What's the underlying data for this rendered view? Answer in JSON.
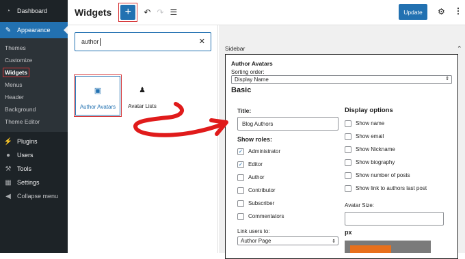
{
  "sidebar": {
    "dashboard": "Dashboard",
    "appearance": "Appearance",
    "submenu": [
      "Themes",
      "Customize",
      "Widgets",
      "Menus",
      "Header",
      "Background",
      "Theme Editor"
    ],
    "plugins": "Plugins",
    "users": "Users",
    "tools": "Tools",
    "settings": "Settings",
    "collapse": "Collapse menu"
  },
  "header": {
    "title": "Widgets",
    "add": "+",
    "update": "Update"
  },
  "inserter": {
    "search_value": "author",
    "blocks": [
      {
        "label": "Author Avatars"
      },
      {
        "label": "Avatar Lists"
      }
    ]
  },
  "editor": {
    "area": "Sidebar",
    "widget": {
      "title": "Author Avatars",
      "sorting_label": "Sorting order:",
      "sorting_value": "Display Name",
      "basic": "Basic",
      "title_label": "Title:",
      "title_value": "Blog Authors",
      "roles_label": "Show roles:",
      "roles": [
        {
          "label": "Administrator",
          "checked": true
        },
        {
          "label": "Editor",
          "checked": true
        },
        {
          "label": "Author",
          "checked": false
        },
        {
          "label": "Contributor",
          "checked": false
        },
        {
          "label": "Subscriber",
          "checked": false
        },
        {
          "label": "Commentators",
          "checked": false
        }
      ],
      "link_label": "Link users to:",
      "link_value": "Author Page",
      "display_label": "Display options",
      "display_options": [
        "Show name",
        "Show email",
        "Show Nickname",
        "Show biography",
        "Show number of posts",
        "Show link to authors last post"
      ],
      "avatar_size_label": "Avatar Size:",
      "px": "px"
    }
  },
  "colors": {
    "accent": "#2271b1",
    "highlight": "#d63638",
    "sidebar": "#1d2327"
  }
}
